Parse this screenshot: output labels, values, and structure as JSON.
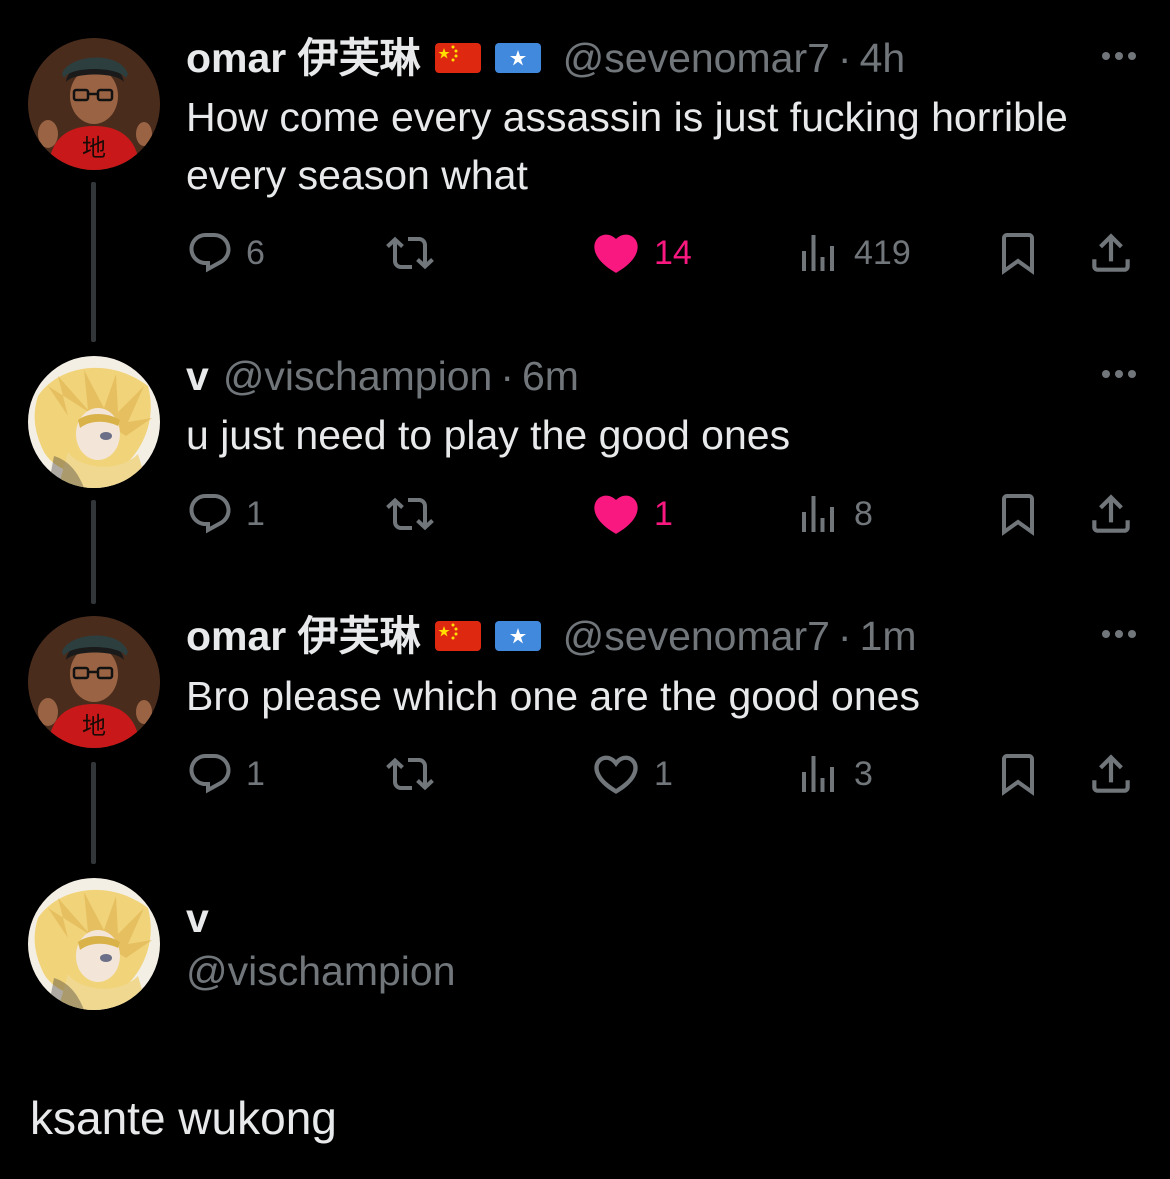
{
  "tweets": [
    {
      "display_name": "omar 伊芙琳",
      "flags": [
        "china-flag",
        "somalia-flag"
      ],
      "handle": "@sevenomar7",
      "dot": "·",
      "time": "4h",
      "text": "How come every assassin is just fucking horrible every season what",
      "replies": "6",
      "retweets": "",
      "likes": "14",
      "liked": true,
      "views": "419"
    },
    {
      "display_name": "v",
      "flags": [],
      "handle": "@vischampion",
      "dot": "·",
      "time": "6m",
      "text": "u just need to play the good ones",
      "replies": "1",
      "retweets": "",
      "likes": "1",
      "liked": true,
      "views": "8"
    },
    {
      "display_name": "omar 伊芙琳",
      "flags": [
        "china-flag",
        "somalia-flag"
      ],
      "handle": "@sevenomar7",
      "dot": "·",
      "time": "1m",
      "text": "Bro please which one are the good ones",
      "replies": "1",
      "retweets": "",
      "likes": "1",
      "liked": false,
      "views": "3"
    }
  ],
  "reply_composer": {
    "display_name": "v",
    "handle": "@vischampion",
    "text": "ksante wukong"
  },
  "colors": {
    "background": "#000000",
    "text_primary": "#e7e9ea",
    "text_secondary": "#71767b",
    "like_pink": "#f91880",
    "thread_line": "#333639"
  },
  "icons": [
    "reply-icon",
    "retweet-icon",
    "like-icon",
    "views-icon",
    "bookmark-icon",
    "share-icon",
    "more-icon"
  ]
}
